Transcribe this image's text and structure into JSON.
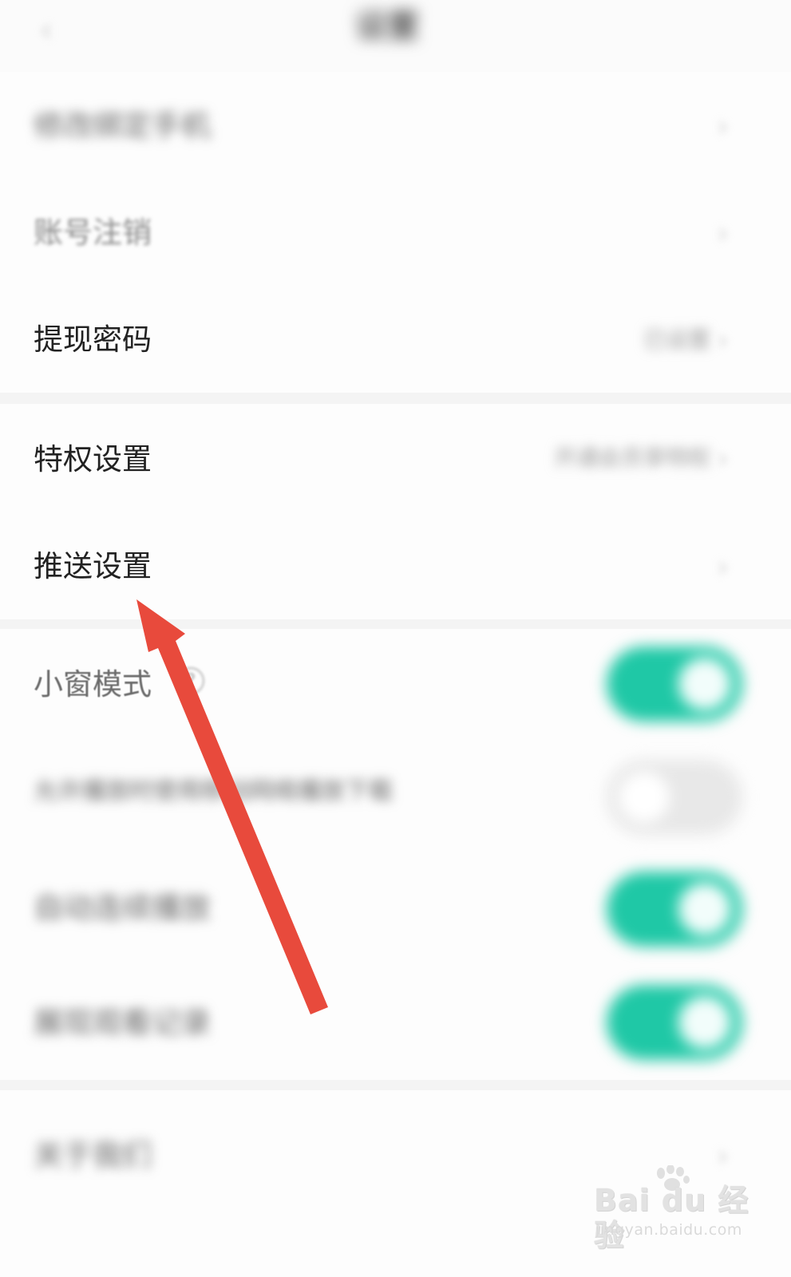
{
  "nav": {
    "back_icon": "chevron-left-icon",
    "title": "设置"
  },
  "group1": {
    "rows": [
      {
        "label": "修改绑定手机",
        "clarity": "blurred"
      },
      {
        "label": "账号注销",
        "clarity": "semi-blurred"
      },
      {
        "label": "提现密码",
        "value": "已设置"
      }
    ]
  },
  "group2": {
    "rows": [
      {
        "label": "特权设置",
        "value": "开通会员享特权"
      },
      {
        "label": "推送设置"
      }
    ]
  },
  "group3": {
    "rows": [
      {
        "label": "小窗模式",
        "help_glyph": "?",
        "toggle_on": true
      },
      {
        "label": "允许播放时使用移动网络播放下载",
        "toggle_on": false
      },
      {
        "label": "自动连续播放",
        "toggle_on": true
      },
      {
        "label": "展现观看记录",
        "toggle_on": true
      }
    ]
  },
  "group4": {
    "rows": [
      {
        "label": "关于我们"
      }
    ]
  },
  "colors": {
    "toggle_on": "#1fc8a6",
    "arrow": "#e84a3c"
  },
  "annotation": {
    "arrow_target": "推送设置"
  },
  "watermark": {
    "logo": "Bai du 经验",
    "url": "jingyan.baidu.com"
  }
}
